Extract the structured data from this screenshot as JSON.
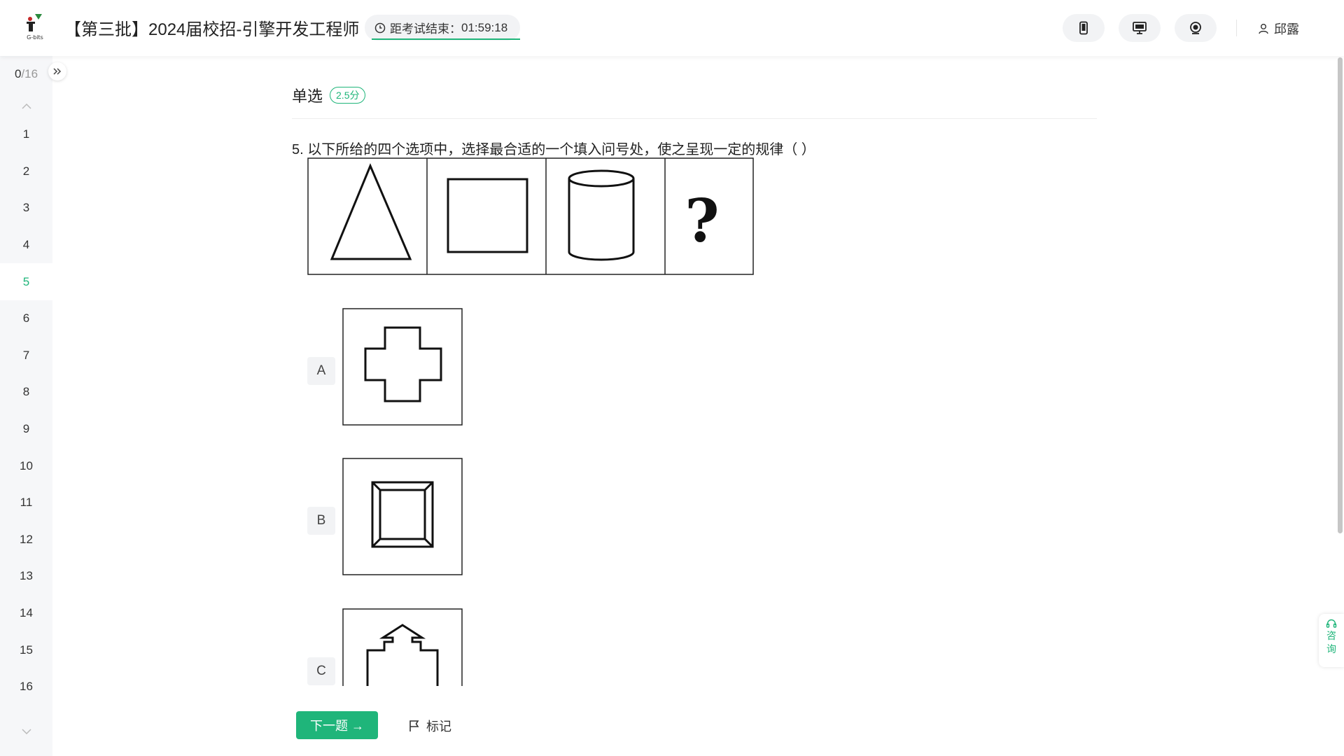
{
  "header": {
    "logo_text": "G-bits",
    "exam_title": "【第三批】2024届校招-引擎开发工程师",
    "timer_label": "距考试结束：",
    "timer_value": "01:59:18",
    "icons": [
      "phone-icon",
      "monitor-icon",
      "camera-icon"
    ],
    "user_name": "邱露"
  },
  "sidebar": {
    "answered": "0",
    "total": "/16",
    "questions": [
      "1",
      "2",
      "3",
      "4",
      "5",
      "6",
      "7",
      "8",
      "9",
      "10",
      "11",
      "12",
      "13",
      "14",
      "15",
      "16"
    ],
    "active_index": 4
  },
  "main": {
    "question_type": "单选",
    "score": "2.5分",
    "question_text": "5. 以下所给的四个选项中，选择最合适的一个填入问号处，使之呈现一定的规律（ ）",
    "stem_shapes": [
      "triangle",
      "square",
      "cylinder",
      "question-mark"
    ],
    "stem_question_mark": "?",
    "options": [
      {
        "letter": "A",
        "shape": "cross"
      },
      {
        "letter": "B",
        "shape": "framed-square"
      },
      {
        "letter": "C",
        "shape": "arrow-house"
      }
    ]
  },
  "footer": {
    "next_label": "下一题 →",
    "mark_label": "标记"
  },
  "consult": {
    "char1": "咨",
    "char2": "询"
  },
  "colors": {
    "accent": "#1fb57a",
    "sidebar_bg": "#f6f7f9",
    "pill_bg": "#f2f3f5"
  }
}
